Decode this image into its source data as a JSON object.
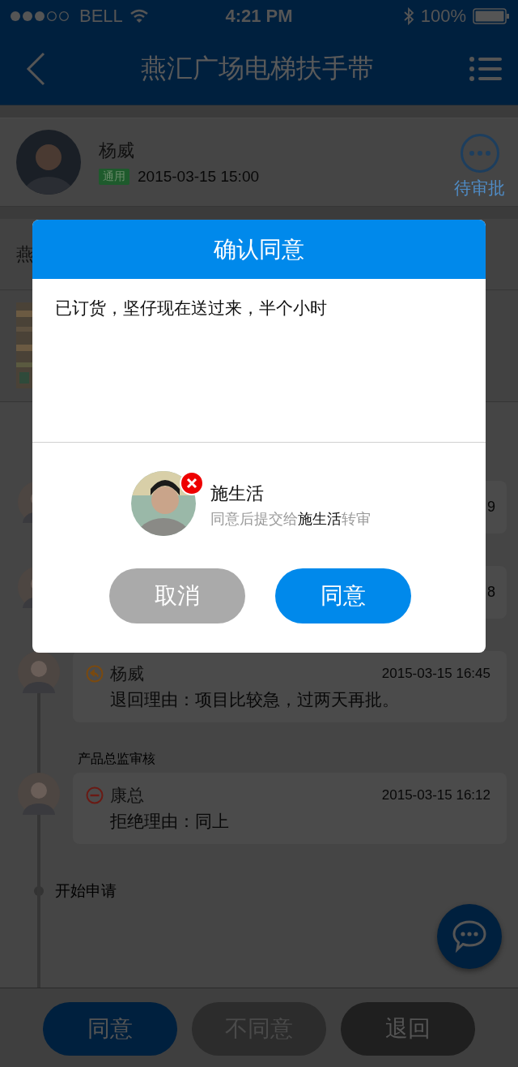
{
  "status_bar": {
    "carrier": "BELL",
    "time": "4:21 PM",
    "battery": "100%"
  },
  "nav": {
    "title": "燕汇广场电梯扶手带"
  },
  "request": {
    "applicant": "杨威",
    "tag": "通用",
    "time": "2015-03-15 15:00",
    "status": "待审批"
  },
  "project_title_fragment": "燕",
  "history": [
    {
      "kind": "partial",
      "time_fragment": "9"
    },
    {
      "kind": "partial",
      "time_fragment": "8"
    },
    {
      "kind": "returned",
      "name": "杨威",
      "time": "2015-03-15 16:45",
      "reason": "退回理由：项目比较急，过两天再批。"
    },
    {
      "kind": "rejected",
      "stage": "产品总监审核",
      "name": "康总",
      "time": "2015-03-15 16:12",
      "reason": "拒绝理由：同上"
    }
  ],
  "start_label": "开始申请",
  "actions": [
    {
      "kind": "approve",
      "label": "同意"
    },
    {
      "kind": "disagree",
      "label": "不同意"
    },
    {
      "kind": "return",
      "label": "退回"
    }
  ],
  "dialog": {
    "title": "确认同意",
    "comment": "已订货，坚仔现在送过来，半个小时",
    "next_approver": {
      "name": "施生活",
      "note": "同意后提交给**施生活**转审"
    },
    "buttons": [
      {
        "kind": "cancel",
        "label": "取消"
      },
      {
        "kind": "confirm",
        "label": "同意"
      }
    ]
  }
}
